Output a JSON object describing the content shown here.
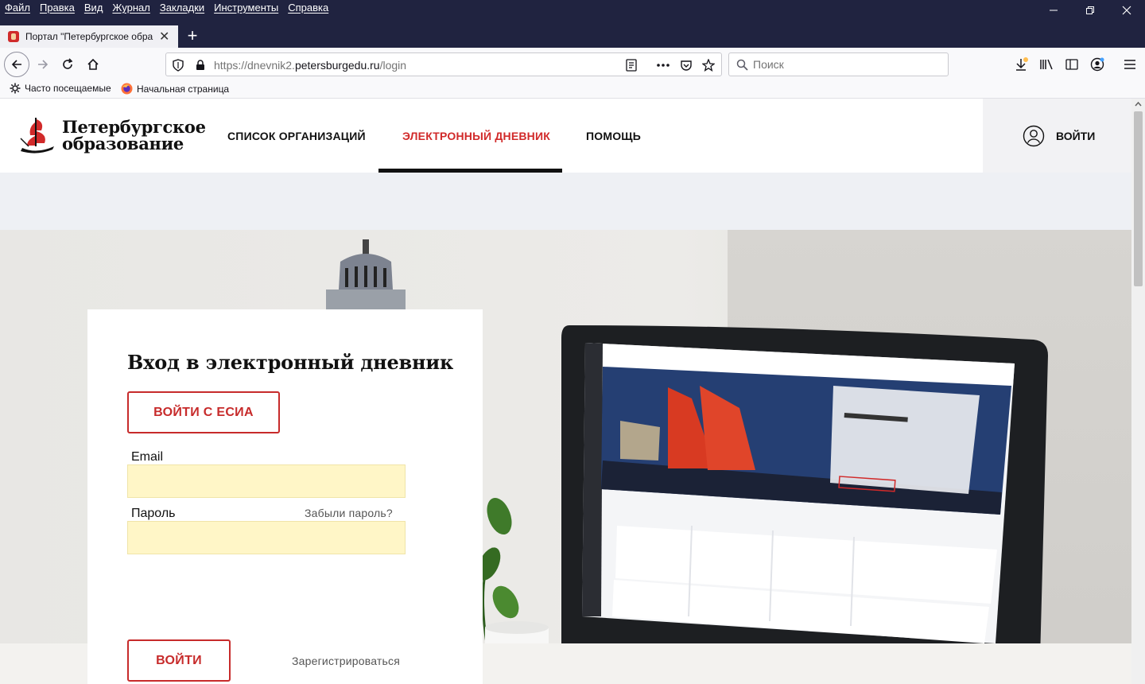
{
  "menubar": {
    "items": [
      "Файл",
      "Правка",
      "Вид",
      "Журнал",
      "Закладки",
      "Инструменты",
      "Справка"
    ]
  },
  "tab": {
    "title": "Портал \"Петербургское обра"
  },
  "urlbar": {
    "prefix": "https://dnevnik2.",
    "host": "petersburgedu.ru",
    "path": "/login"
  },
  "search": {
    "placeholder": "Поиск"
  },
  "bookmarks": {
    "most_visited": "Часто посещаемые",
    "home": "Начальная страница"
  },
  "site": {
    "logo_line1": "Петербургское",
    "logo_line2": "образование",
    "nav": [
      "СПИСОК ОРГАНИЗАЦИЙ",
      "ЭЛЕКТРОННЫЙ ДНЕВНИК",
      "ПОМОЩЬ"
    ],
    "login": "ВОЙТИ"
  },
  "card": {
    "title": "Вход в электронный дневник",
    "esia_button": "ВОЙТИ С ЕСИА",
    "email_label": "Email",
    "password_label": "Пароль",
    "forgot": "Забыли пароль?",
    "submit": "ВОЙТИ",
    "register": "Зарегистрироваться"
  },
  "colors": {
    "accent": "#c72b2b",
    "chrome": "#202340",
    "field_bg": "#fff6c7"
  }
}
